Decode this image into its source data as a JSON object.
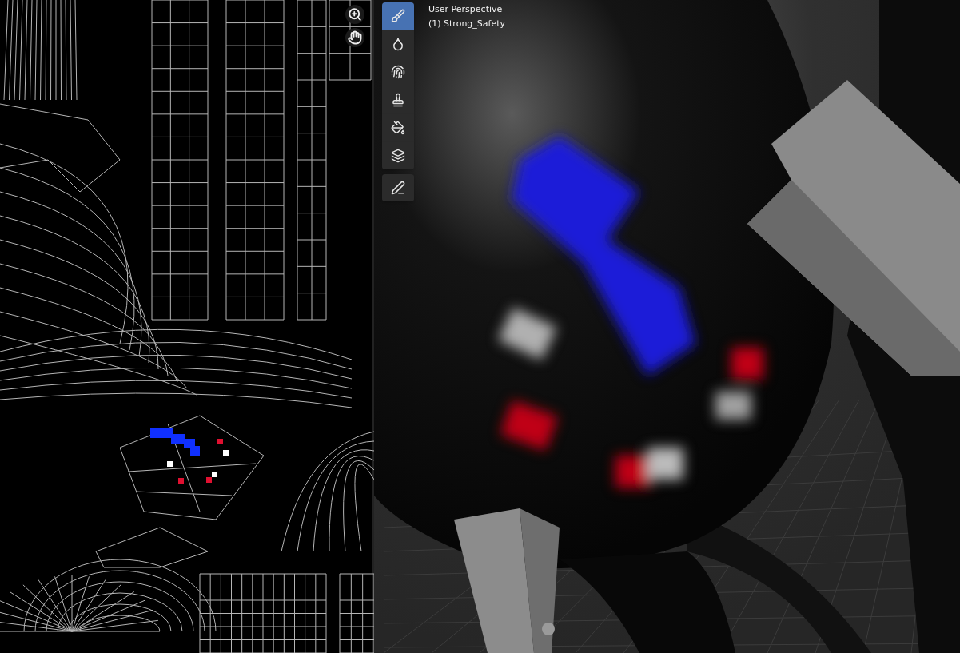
{
  "viewport": {
    "view_name": "User Perspective",
    "object_name": "(1) Strong_Safety"
  },
  "tool_groups": [
    [
      {
        "kind": "draw",
        "selected": true
      },
      {
        "kind": "blur",
        "selected": false
      },
      {
        "kind": "smear",
        "selected": false
      },
      {
        "kind": "clone",
        "selected": false
      },
      {
        "kind": "fill",
        "selected": false
      },
      {
        "kind": "mask",
        "selected": false
      }
    ],
    [
      {
        "kind": "annotate",
        "selected": false
      }
    ]
  ]
}
